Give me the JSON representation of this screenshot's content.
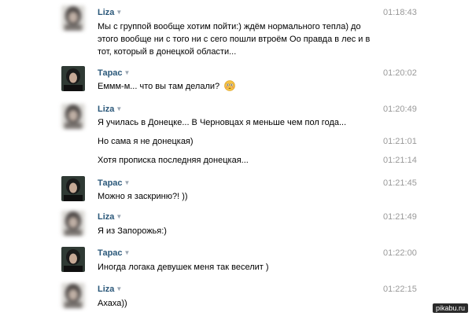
{
  "messages": [
    {
      "author": "Liza",
      "time": "01:18:43",
      "lines": [
        "Мы с группой вообще хотим пойти:) ждём нормального тепла) до",
        "этого вообще ни с того ни с сего пошли втроём Оо правда в лес и в",
        "тот, который в донецкой области..."
      ]
    },
    {
      "author": "Тарас",
      "time": "01:20:02",
      "lines": [
        "Еммм-м... что вы там делали?"
      ]
    },
    {
      "author": "Liza",
      "time": "01:20:49",
      "lines": [
        "Я училась в Донецке... В Черновцах я меньше чем пол года..."
      ]
    },
    {
      "time": "01:21:01",
      "lines": [
        "Но сама я не донецкая)"
      ]
    },
    {
      "time": "01:21:14",
      "lines": [
        "Хотя прописка последняя донецкая..."
      ]
    },
    {
      "author": "Тарас",
      "time": "01:21:45",
      "lines": [
        "Можно я заскриню?! ))"
      ]
    },
    {
      "author": "Liza",
      "time": "01:21:49",
      "lines": [
        "Я из Запорожья:)"
      ]
    },
    {
      "author": "Тарас",
      "time": "01:22:00",
      "lines": [
        "Иногда логака девушек меня так веселит )"
      ]
    },
    {
      "author": "Liza",
      "time": "01:22:15",
      "lines": [
        "Ахаха))"
      ]
    }
  ],
  "icons": {
    "caret": "caret-down-icon",
    "emoji": "flushed-face-emoji-icon"
  },
  "colors": {
    "author_name": "#2b587a",
    "timestamp": "#999999"
  },
  "watermark": "pikabu.ru"
}
